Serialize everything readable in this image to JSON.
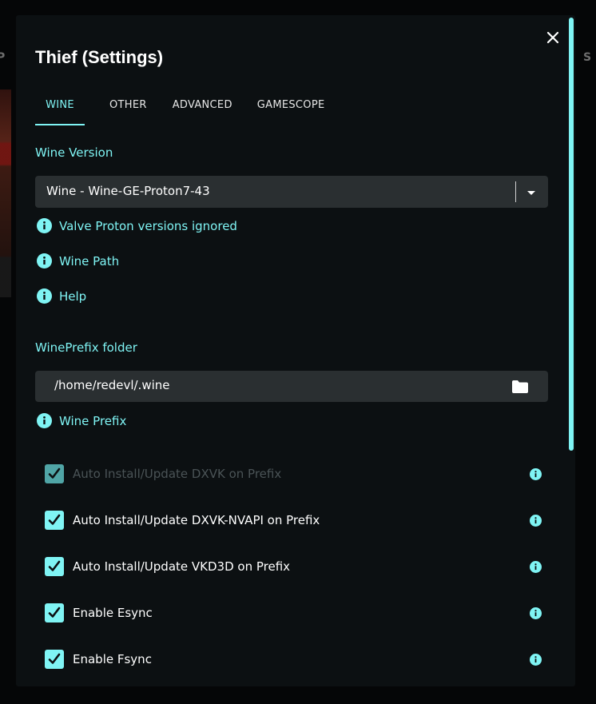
{
  "modal": {
    "title": "Thief (Settings)"
  },
  "tabs": [
    {
      "label": "WINE",
      "active": true
    },
    {
      "label": "OTHER",
      "active": false
    },
    {
      "label": "ADVANCED",
      "active": false
    },
    {
      "label": "GAMESCOPE",
      "active": false
    }
  ],
  "wine_version": {
    "label": "Wine Version",
    "selected": "Wine - Wine-GE-Proton7-43"
  },
  "info_links": {
    "proton_ignored": "Valve Proton versions ignored",
    "wine_path": "Wine Path",
    "help": "Help",
    "wine_prefix": "Wine Prefix"
  },
  "prefix": {
    "label": "WinePrefix folder",
    "value": "/home/redevl/.wine"
  },
  "checkboxes": [
    {
      "label": "Auto Install/Update DXVK on Prefix",
      "checked": true,
      "disabled": true
    },
    {
      "label": "Auto Install/Update DXVK-NVAPI on Prefix",
      "checked": true,
      "disabled": false
    },
    {
      "label": "Auto Install/Update VKD3D on Prefix",
      "checked": true,
      "disabled": false
    },
    {
      "label": "Enable Esync",
      "checked": true,
      "disabled": false
    },
    {
      "label": "Enable Fsync",
      "checked": true,
      "disabled": false
    }
  ],
  "colors": {
    "accent": "#7ff4f4",
    "modal_bg": "#0c1012",
    "input_bg": "#2a2f31"
  },
  "icons": {
    "close": "close-icon",
    "dropdown": "chevron-down-icon",
    "info": "info-icon",
    "folder": "folder-icon",
    "check": "checkmark-icon"
  }
}
